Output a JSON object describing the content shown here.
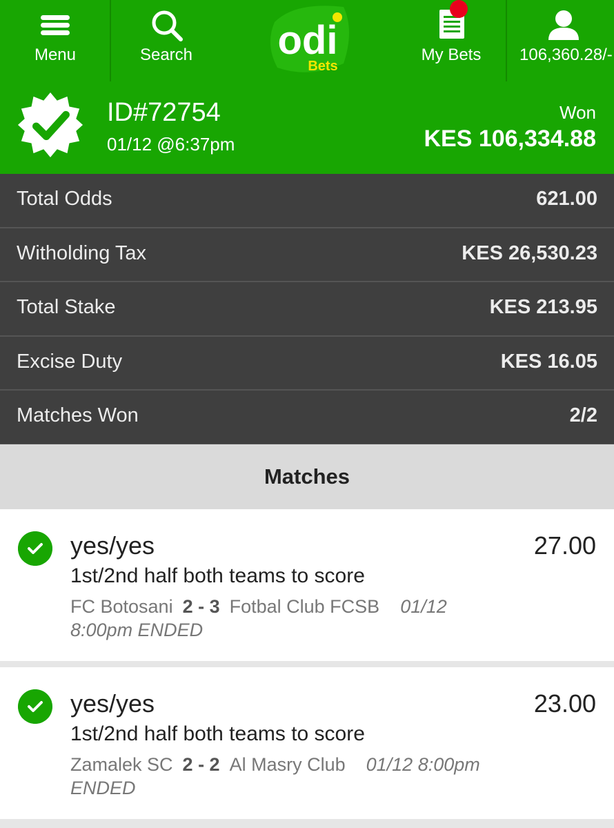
{
  "nav": {
    "menu_label": "Menu",
    "search_label": "Search",
    "logo_main": "odi",
    "logo_sub": "Bets",
    "mybets_label": "My Bets",
    "balance_label": "106,360.28/-"
  },
  "bet": {
    "id": "ID#72754",
    "date": "01/12 @6:37pm",
    "status": "Won",
    "amount": "KES 106,334.88"
  },
  "summary": [
    {
      "label": "Total Odds",
      "value": "621.00"
    },
    {
      "label": "Witholding Tax",
      "value": "KES 26,530.23"
    },
    {
      "label": "Total Stake",
      "value": "KES 213.95"
    },
    {
      "label": "Excise Duty",
      "value": "KES 16.05"
    },
    {
      "label": "Matches Won",
      "value": "2/2"
    }
  ],
  "matches_title": "Matches",
  "matches": [
    {
      "pick": "yes/yes",
      "odds": "27.00",
      "market": "1st/2nd half both teams to score",
      "home": "FC Botosani",
      "score": "2 - 3",
      "away": "Fotbal Club FCSB",
      "time": "01/12 8:00pm ENDED"
    },
    {
      "pick": "yes/yes",
      "odds": "23.00",
      "market": "1st/2nd half both teams to score",
      "home": "Zamalek SC",
      "score": "2 - 2",
      "away": "Al Masry Club",
      "time": "01/12 8:00pm ENDED"
    }
  ],
  "colors": {
    "brand_green": "#18a602",
    "summary_bg": "#3f3f3f",
    "notification_dot": "#e8001c",
    "logo_yellow": "#f3e600"
  },
  "icons": [
    "menu-icon",
    "search-icon",
    "betslip-icon",
    "user-icon",
    "verified-badge-icon",
    "check-circle-icon"
  ]
}
